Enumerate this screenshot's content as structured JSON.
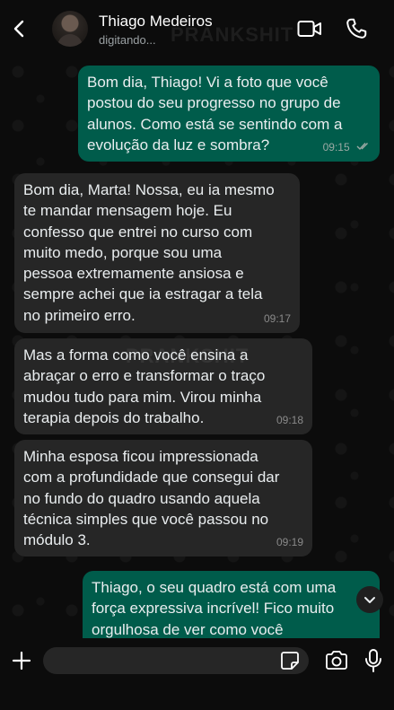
{
  "header": {
    "contact_name": "Thiago Medeiros",
    "status": "digitando...",
    "watermark": "PRANKSHIT"
  },
  "messages": [
    {
      "direction": "out",
      "text": "Bom dia, Thiago! Vi a foto que você\npostou do seu progresso no grupo de\nalunos. Como está se sentindo com a\nevolução da luz e sombra?",
      "time": "09:15",
      "read": true
    },
    {
      "direction": "in",
      "text": "Bom dia, Marta! Nossa, eu ia mesmo\nte mandar mensagem hoje. Eu\nconfesso que entrei no curso com\nmuito medo, porque sou uma\npessoa extremamente ansiosa e\nsempre achei que ia estragar a tela\nno primeiro erro.",
      "time": "09:17"
    },
    {
      "direction": "in",
      "text": "Mas a forma como você ensina a\nabraçar o erro e transformar o traço\nmudou tudo para mim. Virou minha\nterapia depois do trabalho.",
      "time": "09:18"
    },
    {
      "direction": "in",
      "text": "Minha esposa ficou impressionada\ncom a profundidade que consegui dar\nno fundo do quadro usando aquela\ntécnica simples que você passou no\nmódulo 3.",
      "time": "09:19"
    },
    {
      "direction": "out",
      "text": "Thiago, o seu quadro está com uma\nforça expressiva incrível! Fico muito\norgulhosa de ver como você",
      "time": ""
    }
  ],
  "watermark_mid": "PRANKSHIT",
  "composer": {
    "placeholder": "",
    "value": ""
  },
  "colors": {
    "outgoing_bubble": "#005c4b",
    "incoming_bubble": "#262626",
    "background": "#0c0c0c"
  },
  "icons": [
    "back-arrow-icon",
    "video-call-icon",
    "phone-icon",
    "chevron-down-icon",
    "plus-icon",
    "sticker-icon",
    "camera-icon",
    "microphone-icon"
  ]
}
